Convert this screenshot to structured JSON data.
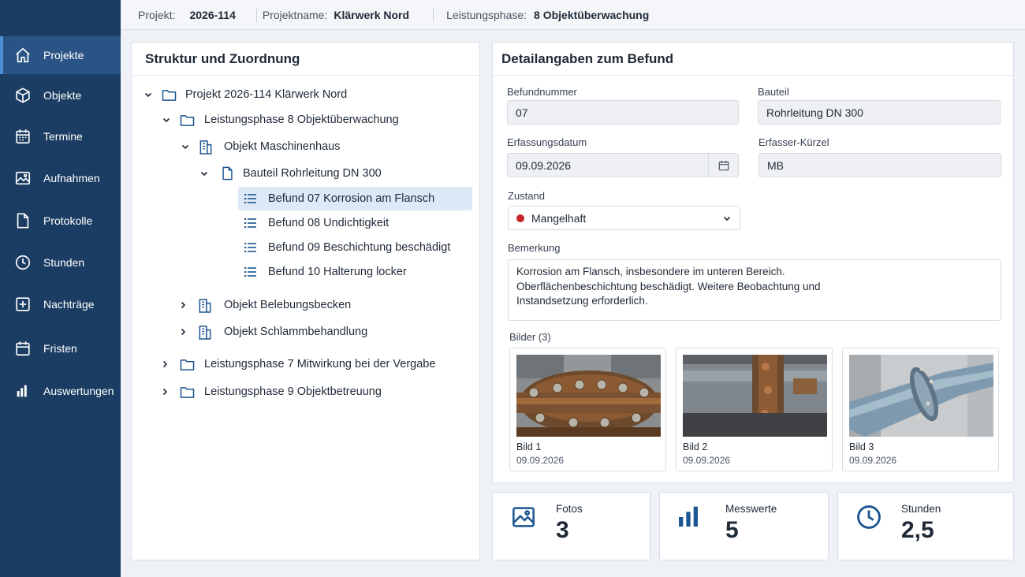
{
  "header": {
    "project_key": "Projekt:",
    "project_value": "2026-114",
    "name_key": "Projektname:",
    "name_value": "Klärwerk Nord",
    "phase_key": "Leistungsphase:",
    "phase_value": "8 Objektüberwachung"
  },
  "sidebar": {
    "items": [
      {
        "label": "Projekte",
        "icon": "home-icon",
        "active": true
      },
      {
        "label": "Objekte",
        "icon": "cube-icon"
      },
      {
        "label": "Termine",
        "icon": "calendar-icon"
      },
      {
        "label": "Aufnahmen",
        "icon": "image-icon"
      },
      {
        "label": "Protokolle",
        "icon": "document-icon"
      },
      {
        "label": "Stunden",
        "icon": "clock-icon"
      },
      {
        "label": "Nachträge",
        "icon": "plus-square-icon"
      },
      {
        "label": "Fristen",
        "icon": "calendar-icon"
      },
      {
        "label": "Auswertungen",
        "icon": "bar-chart-icon"
      }
    ]
  },
  "tree_panel": {
    "title": "Struktur und Zuordnung",
    "nodes": [
      {
        "label": "Projekt 2026-114  Klärwerk Nord",
        "icon": "folder-icon",
        "expanded": true
      },
      {
        "label": "Leistungsphase 8 Objektüberwachung",
        "icon": "folder-icon",
        "expanded": true
      },
      {
        "label": "Objekt Maschinenhaus",
        "icon": "building-icon",
        "expanded": true
      },
      {
        "label": "Bauteil Rohrleitung DN 300",
        "icon": "document-icon",
        "expanded": true
      },
      {
        "label": "Befund 07 Korrosion am Flansch",
        "icon": "list-icon",
        "selected": true
      },
      {
        "label": "Befund 08 Undichtigkeit",
        "icon": "list-icon"
      },
      {
        "label": "Befund 09 Beschichtung beschädigt",
        "icon": "list-icon"
      },
      {
        "label": "Befund 10 Halterung locker",
        "icon": "list-icon"
      },
      {
        "label": "Objekt Belebungsbecken",
        "icon": "building-icon",
        "expanded": false
      },
      {
        "label": "Objekt Schlammbehandlung",
        "icon": "building-icon",
        "expanded": false
      },
      {
        "label": "Leistungsphase 7 Mitwirkung bei der Vergabe",
        "icon": "folder-icon",
        "expanded": false
      },
      {
        "label": "Leistungsphase 9 Objektbetreuung",
        "icon": "folder-icon",
        "expanded": false
      }
    ]
  },
  "detail_panel": {
    "title": "Detailangaben zum Befund",
    "befundnummer_label": "Befundnummer",
    "befundnummer_value": "07",
    "bauteil_label": "Bauteil",
    "bauteil_value": "Rohrleitung DN 300",
    "datum_label": "Erfassungsdatum",
    "datum_value": "09.09.2026",
    "kuerzel_label": "Erfasser-Kürzel",
    "kuerzel_value": "MB",
    "zustand_label": "Zustand",
    "zustand_value": "Mangelhaft",
    "zustand_color": "#c8242b",
    "bemerkung_label": "Bemerkung",
    "bemerkung_lines": [
      "Korrosion am Flansch, insbesondere im unteren Bereich.",
      "Oberflächenbeschichtung beschädigt. Weitere Beobachtung und",
      "Instandsetzung erforderlich."
    ],
    "bilder_label": "Bilder (3)",
    "bilder": [
      {
        "caption": "Bild 1",
        "date": "09.09.2026"
      },
      {
        "caption": "Bild 2",
        "date": "09.09.2026"
      },
      {
        "caption": "Bild 3",
        "date": "09.09.2026"
      }
    ]
  },
  "stats": [
    {
      "label": "Fotos",
      "value": "3",
      "icon": "image-icon"
    },
    {
      "label": "Messwerte",
      "value": "5",
      "icon": "bar-chart-icon"
    },
    {
      "label": "Stunden",
      "value": "2,5",
      "icon": "clock-icon"
    }
  ],
  "colors": {
    "sidebar_bg": "#1c3d63",
    "sidebar_active": "#2a5485",
    "accent": "#1c5591",
    "selected_row": "#dde9f7"
  }
}
